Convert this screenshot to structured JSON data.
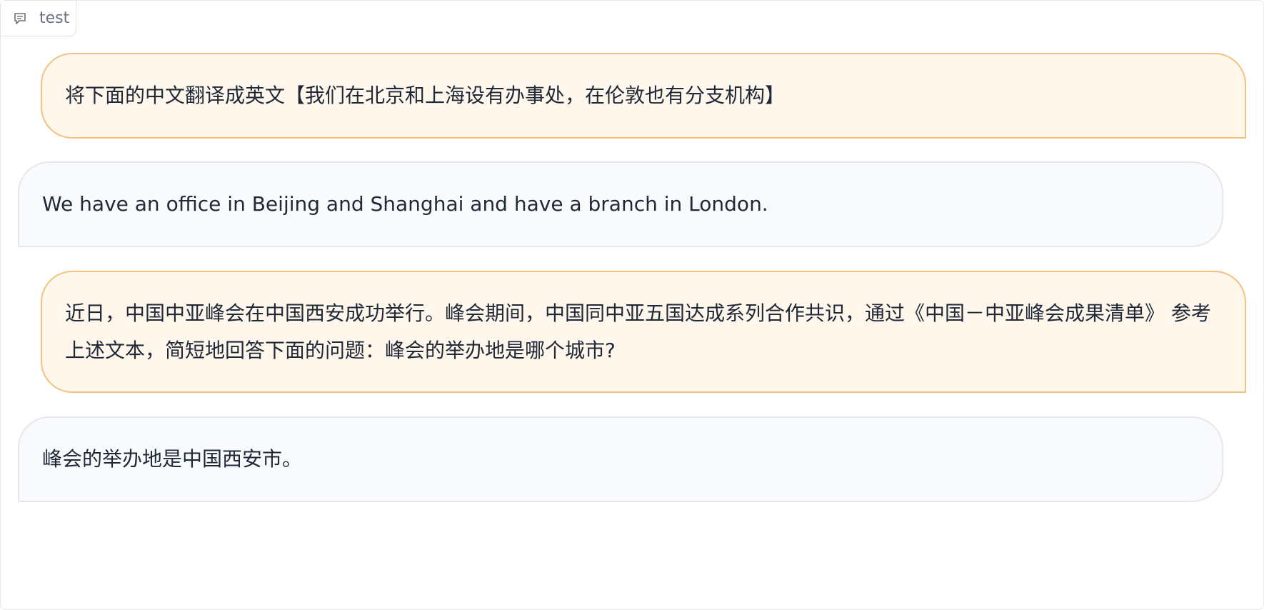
{
  "block": {
    "label": "test",
    "icon": "chat-icon"
  },
  "messages": [
    {
      "role": "user",
      "text": "将下面的中文翻译成英文【我们在北京和上海设有办事处，在伦敦也有分支机构】"
    },
    {
      "role": "bot",
      "text": "We have an office in Beijing and Shanghai and have a branch in London."
    },
    {
      "role": "user",
      "text": "近日，中国中亚峰会在中国西安成功举行。峰会期间，中国同中亚五国达成系列合作共识，通过《中国－中亚峰会成果清单》 参考上述文本，简短地回答下面的问题：峰会的举办地是哪个城市?"
    },
    {
      "role": "bot",
      "text": "峰会的举办地是中国西安市。"
    }
  ],
  "colors": {
    "user_bg": "#fff6ec",
    "user_border": "#f4c27f",
    "bot_bg": "#f9fafb",
    "bot_border": "#e5e7eb"
  }
}
